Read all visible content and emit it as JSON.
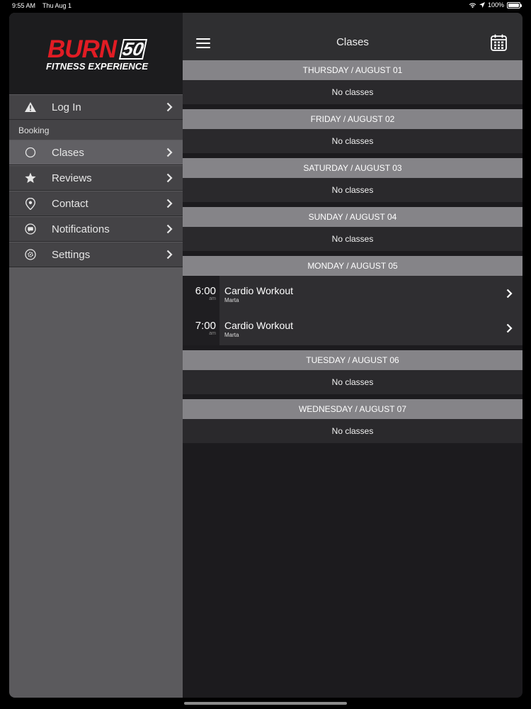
{
  "status_bar": {
    "time": "9:55 AM",
    "date": "Thu Aug 1",
    "battery": "100%"
  },
  "logo": {
    "burn": "BURN",
    "number": "50",
    "subtitle": "FITNESS EXPERIENCE"
  },
  "sidebar": {
    "login_label": "Log In",
    "section_label": "Booking",
    "items": [
      {
        "label": "Clases",
        "icon": "circle-icon"
      },
      {
        "label": "Reviews",
        "icon": "star-icon"
      },
      {
        "label": "Contact",
        "icon": "location-pin-icon"
      },
      {
        "label": "Notifications",
        "icon": "chat-bubble-icon"
      },
      {
        "label": "Settings",
        "icon": "gear-icon"
      }
    ]
  },
  "navbar": {
    "title": "Clases"
  },
  "days": [
    {
      "header": "THURSDAY / AUGUST 01",
      "empty": "No classes"
    },
    {
      "header": "FRIDAY / AUGUST 02",
      "empty": "No classes"
    },
    {
      "header": "SATURDAY / AUGUST 03",
      "empty": "No classes"
    },
    {
      "header": "SUNDAY / AUGUST 04",
      "empty": "No classes"
    },
    {
      "header": "MONDAY / AUGUST 05",
      "classes": [
        {
          "time": "6:00",
          "ampm": "am",
          "name": "Cardio Workout",
          "instructor": "Marta"
        },
        {
          "time": "7:00",
          "ampm": "am",
          "name": "Cardio Workout",
          "instructor": "Marta"
        }
      ]
    },
    {
      "header": "TUESDAY / AUGUST 06",
      "empty": "No classes"
    },
    {
      "header": "WEDNESDAY / AUGUST 07",
      "empty": "No classes"
    }
  ],
  "colors": {
    "brand_red": "#e11c24",
    "day_header_bg": "#858488",
    "sidebar_bg": "#5b5a5d"
  }
}
